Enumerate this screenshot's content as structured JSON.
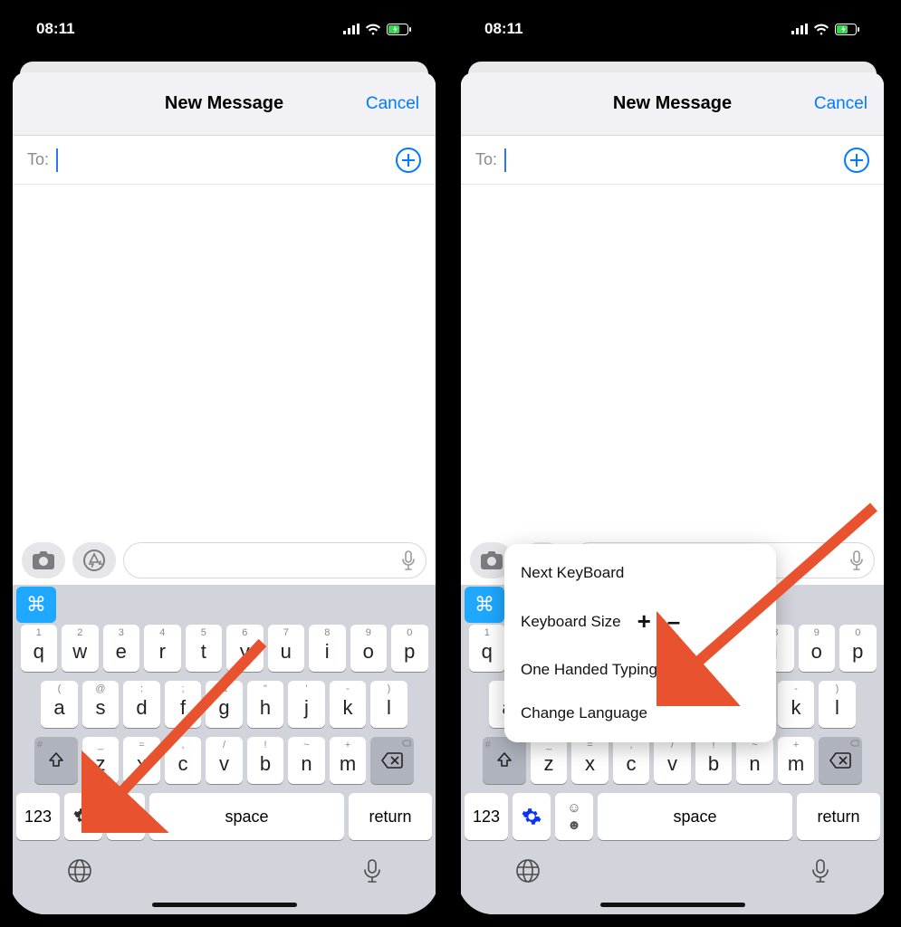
{
  "status": {
    "time": "08:11"
  },
  "nav": {
    "title": "New Message",
    "cancel": "Cancel"
  },
  "to": {
    "label": "To:"
  },
  "keys": {
    "row1": [
      {
        "n": "1",
        "l": "q"
      },
      {
        "n": "2",
        "l": "w"
      },
      {
        "n": "3",
        "l": "e"
      },
      {
        "n": "4",
        "l": "r"
      },
      {
        "n": "5",
        "l": "t"
      },
      {
        "n": "6",
        "l": "y"
      },
      {
        "n": "7",
        "l": "u"
      },
      {
        "n": "8",
        "l": "i"
      },
      {
        "n": "9",
        "l": "o"
      },
      {
        "n": "0",
        "l": "p"
      }
    ],
    "row2": [
      {
        "n": "(",
        "l": "a"
      },
      {
        "n": "@",
        "l": "s"
      },
      {
        "n": ":",
        "l": "d"
      },
      {
        "n": ";",
        "l": "f"
      },
      {
        "n": "&",
        "l": "g"
      },
      {
        "n": "\"",
        "l": "h"
      },
      {
        "n": "'",
        "l": "j"
      },
      {
        "n": "-",
        "l": "k"
      },
      {
        "n": ")",
        "l": "l"
      }
    ],
    "row3": [
      {
        "n": "_",
        "l": "z"
      },
      {
        "n": "=",
        "l": "x"
      },
      {
        "n": ",",
        "l": "c"
      },
      {
        "n": "/",
        "l": "v"
      },
      {
        "n": "!",
        "l": "b"
      },
      {
        "n": "~",
        "l": "n"
      },
      {
        "n": "+",
        "l": "m"
      }
    ],
    "num": "123",
    "space": "space",
    "return": "return",
    "shift_hint": "#",
    "bs_hint": ""
  },
  "popup": {
    "next": "Next KeyBoard",
    "size": "Keyboard Size",
    "plus": "+",
    "minus": "–",
    "one_hand": "One Handed Typing",
    "lang": "Change Language"
  }
}
